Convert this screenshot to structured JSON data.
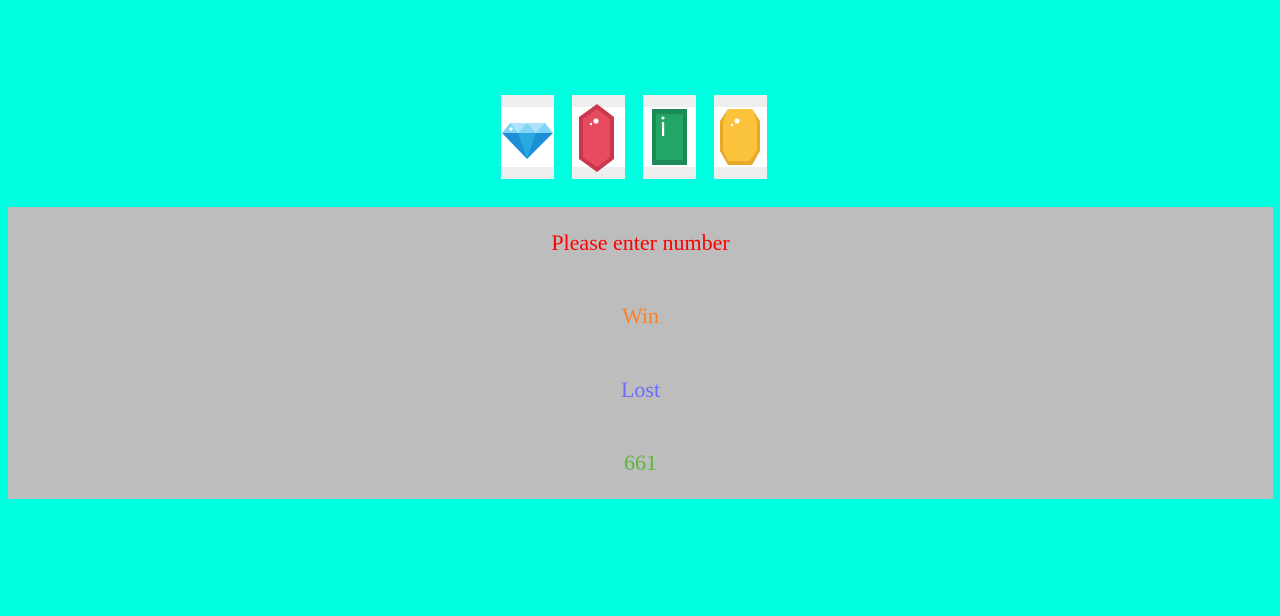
{
  "reels": [
    {
      "icon": "diamond-icon",
      "color": "#29a9e0"
    },
    {
      "icon": "ruby-icon",
      "color": "#e84a5f"
    },
    {
      "icon": "emerald-icon",
      "color": "#22a565"
    },
    {
      "icon": "topaz-icon",
      "color": "#fcc33d"
    }
  ],
  "messages": {
    "prompt": "Please enter number",
    "win": "Win",
    "lost": "Lost",
    "count": "661"
  },
  "colors": {
    "background": "#00ffe0",
    "panel": "#bdbdbd",
    "prompt": "#ff0000",
    "win": "#ff7f27",
    "lost": "#6b6bff",
    "count": "#5cb83a"
  }
}
